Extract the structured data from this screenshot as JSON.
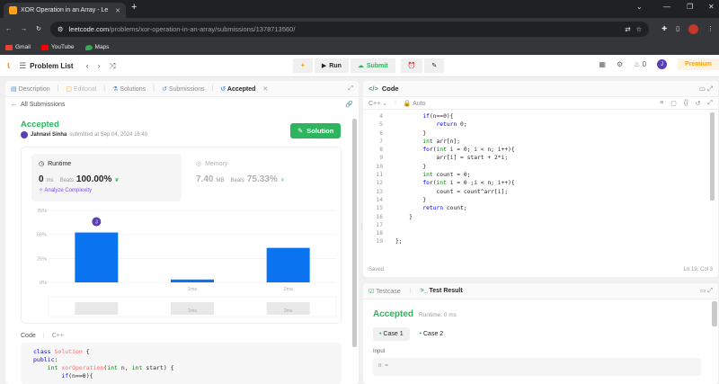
{
  "browser": {
    "tab_title": "XOR Operation in an Array - Le",
    "url_host": "leetcode.com",
    "url_path": "/problems/xor-operation-in-an-array/submissions/1378713560/",
    "bookmarks": [
      {
        "label": "Gmail",
        "color": "#ea4335"
      },
      {
        "label": "YouTube",
        "color": "#ff0000"
      },
      {
        "label": "Maps",
        "color": "#34a853"
      }
    ]
  },
  "nav": {
    "problem_list": "Problem List",
    "run": "Run",
    "submit": "Submit",
    "streak": "0",
    "avatar": "J",
    "premium": "Premium"
  },
  "left_panel": {
    "tabs": [
      "Description",
      "Editorial",
      "Solutions",
      "Submissions",
      "Accepted"
    ],
    "all_submissions": "All Submissions",
    "status": "Accepted",
    "author": "Jahnavi Sinha",
    "submitted_text": "submitted at Sep 04, 2024 16:40",
    "solution_button": "Solution",
    "runtime": {
      "title": "Runtime",
      "value": "0",
      "unit": "ms",
      "beats_label": "Beats",
      "beats": "100.00%",
      "analyze": "Analyze Complexity"
    },
    "memory": {
      "title": "Memory",
      "value": "7.40",
      "unit": "MB",
      "beats_label": "Beats",
      "beats": "75.33%"
    },
    "code_label": "Code",
    "lang": "C++",
    "code_lines": [
      "class Solution {",
      "public:",
      "    int xorOperation(int n, int start) {",
      "        if(n==0){"
    ]
  },
  "chart_data": {
    "type": "bar",
    "categories": [
      "0ms",
      "1ms",
      "2ms"
    ],
    "values": [
      52,
      3,
      36
    ],
    "ylim": [
      0,
      75
    ],
    "yticks": [
      "0%",
      "25%",
      "50%",
      "75%"
    ],
    "user_marker": {
      "category": "0ms",
      "label": "J"
    },
    "grid": true,
    "bar_color": "#0a74f0"
  },
  "editor": {
    "title": "Code",
    "language": "C++",
    "mode": "Auto",
    "line_numbers": [
      "4",
      "5",
      "6",
      "7",
      "8",
      "9",
      "10",
      "11",
      "12",
      "13",
      "14",
      "15",
      "16",
      "17",
      "18",
      "19"
    ],
    "lines": [
      "        if(n==0){",
      "            return 0;",
      "        }",
      "        int arr[n];",
      "        for(int i = 0; i < n; i++){",
      "            arr[i] = start + 2*i;",
      "        }",
      "        int count = 0;",
      "        for(int i = 0 ;i < n; i++){",
      "            count = count^arr[i];",
      "        }",
      "        return count;",
      "    }",
      "",
      "",
      "};"
    ],
    "saved": "Saved",
    "cursor": "Ln 19, Col 3"
  },
  "test_result": {
    "tabs": [
      "Testcase",
      "Test Result"
    ],
    "status": "Accepted",
    "runtime": "Runtime: 0 ms",
    "cases": [
      "Case 1",
      "Case 2"
    ],
    "input_label": "Input",
    "input_line": "n ="
  }
}
